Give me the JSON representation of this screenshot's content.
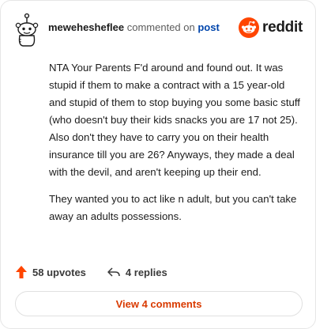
{
  "comment": {
    "username": "mewehesheflee",
    "action_text": "commented on",
    "post_link": "post",
    "paragraphs": [
      "NTA Your Parents F'd around and found out. It was stupid if them to make a contract with a 15 year-old and stupid of them to stop buying you some basic stuff (who doesn't buy their kids snacks you are 17 not 25). Also don't they have to carry you on their health insurance till you are 26? Anyways, they made a deal with the devil, and aren't keeping up their end.",
      "They wanted you to act like n adult, but you can't take away an adults possessions."
    ]
  },
  "brand": {
    "name": "reddit",
    "icon": "reddit-snoo-icon",
    "color": "#ff4500"
  },
  "stats": {
    "upvotes": "58 upvotes",
    "replies": "4 replies",
    "upvote_icon": "upvote-arrow-icon",
    "upvote_color": "#ff4500",
    "reply_icon": "reply-arrow-icon"
  },
  "footer": {
    "view_comments_label": "View 4 comments",
    "accent": "#d93a00"
  },
  "avatar": {
    "icon": "snoo-avatar-icon"
  }
}
